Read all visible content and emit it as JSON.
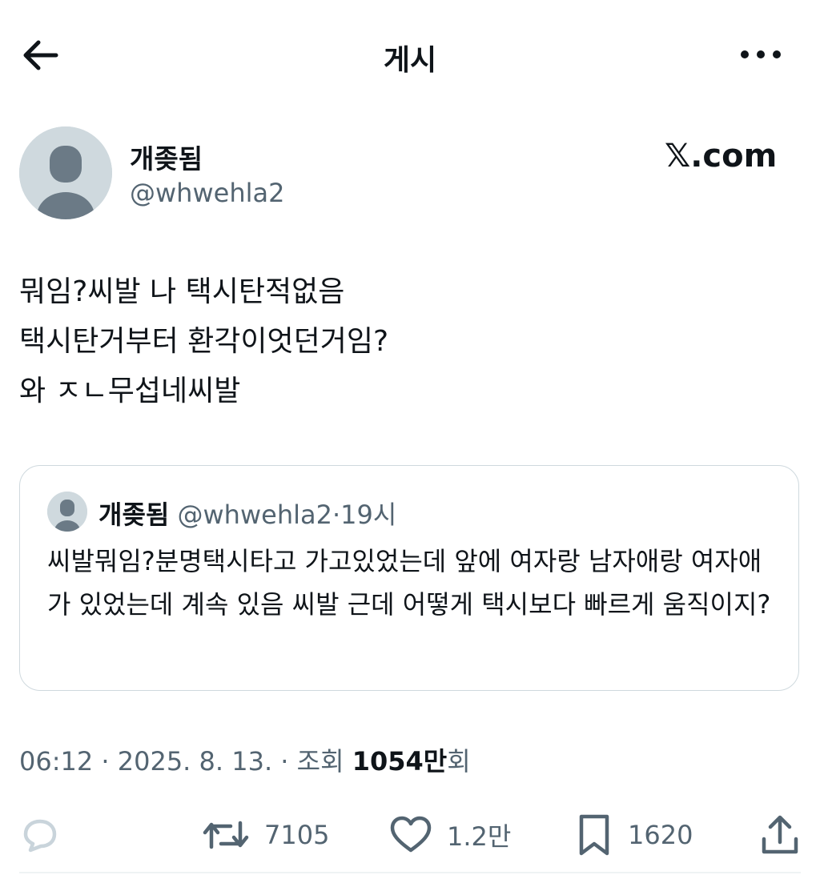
{
  "header": {
    "title": "게시"
  },
  "author": {
    "display_name": "개좆됨",
    "handle": "@whwehla2"
  },
  "watermark": "𝕏.com",
  "post": {
    "text": "뭐임?씨발 나 택시탄적없음\n택시탄거부터 환각이엇던거임?\n와 ㅈㄴ무섭네씨발"
  },
  "quote": {
    "display_name": "개좆됨",
    "handle": "@whwehla2",
    "separator": "·",
    "time_ago": "19시",
    "text": "씨발뭐임?분명택시타고 가고있었는데 앞에 여자랑 남자애랑 여자애가 있었는데 계속 있음 씨발 근데 어떻게 택시보다 빠르게 움직이지?"
  },
  "meta": {
    "time": "06:12",
    "date": "2025. 8. 13.",
    "views_label": "조회",
    "views_count": "1054만",
    "views_suffix": "회"
  },
  "actions": {
    "retweets": "7105",
    "likes": "1.2만",
    "bookmarks": "1620"
  },
  "icons": {
    "back": "arrow-left-icon",
    "more": "more-horizontal-icon",
    "reply": "reply-icon",
    "retweet": "retweet-icon",
    "like": "heart-icon",
    "bookmark": "bookmark-icon",
    "share": "share-icon"
  },
  "colors": {
    "text_primary": "#0f1419",
    "text_secondary": "#536471",
    "border": "#cfd9de",
    "avatar_bg": "#cfd9de",
    "avatar_fg": "#6b7a86",
    "reply_icon": "#c9d4db"
  }
}
